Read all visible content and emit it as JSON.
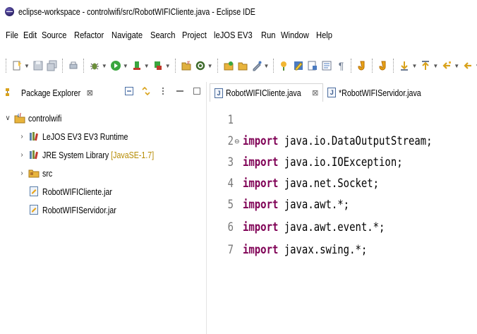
{
  "window": {
    "title": "eclipse-workspace - controlwifi/src/RobotWIFICliente.java - Eclipse IDE"
  },
  "menu": [
    "File",
    "Edit",
    "Source",
    "Refactor",
    "Navigate",
    "Search",
    "Project",
    "leJOS EV3",
    "Run",
    "Window",
    "Help"
  ],
  "package_explorer": {
    "title": "Package Explorer",
    "tree": {
      "project": "controlwifi",
      "runtime": "LeJOS EV3 EV3 Runtime",
      "jre_label": "JRE System Library",
      "jre_decoration": "[JavaSE-1.7]",
      "src": "src",
      "jar1": "RobotWIFICliente.jar",
      "jar2": "RobotWIFIServidor.jar"
    }
  },
  "editor": {
    "tabs": [
      "RobotWIFICliente.java",
      "*RobotWIFIServidor.java"
    ],
    "lines": [
      {
        "num": "1",
        "kw": "",
        "text": ""
      },
      {
        "num": "2",
        "kw": "import",
        "text": " java.io.DataOutputStream;"
      },
      {
        "num": "3",
        "kw": "import",
        "text": " java.io.IOException;"
      },
      {
        "num": "4",
        "kw": "import",
        "text": " java.net.Socket;"
      },
      {
        "num": "5",
        "kw": "import",
        "text": " java.awt.*;"
      },
      {
        "num": "6",
        "kw": "import",
        "text": " java.awt.event.*;"
      },
      {
        "num": "7",
        "kw": "import",
        "text": " javax.swing.*;"
      }
    ]
  },
  "colors": {
    "keyword": "#7f0055",
    "line_number": "#787878",
    "folder": "#d9a21b"
  }
}
